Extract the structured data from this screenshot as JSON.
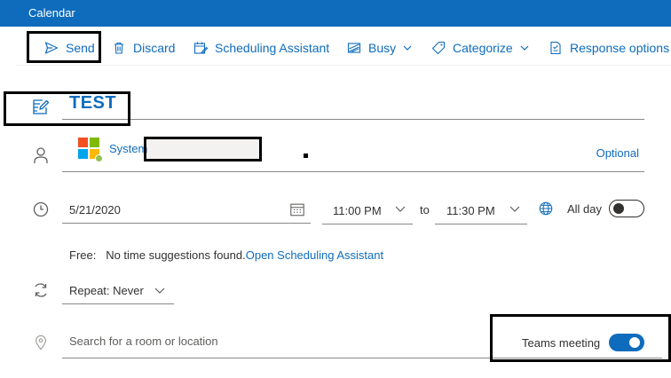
{
  "window": {
    "title": "Calendar"
  },
  "toolbar": {
    "send_label": "Send",
    "discard_label": "Discard",
    "scheduling_label": "Scheduling Assistant",
    "busy_label": "Busy",
    "categorize_label": "Categorize",
    "response_label": "Response options"
  },
  "event": {
    "title": "TEST",
    "attendee_name": "System",
    "optional_label": "Optional",
    "start_date": "5/21/2020",
    "start_time": "11:00 PM",
    "to_label": "to",
    "end_time": "11:30 PM",
    "all_day_label": "All day",
    "all_day_on": false,
    "free_label": "Free:",
    "suggestion_text": "No time suggestions found.",
    "scheduling_link": "Open Scheduling Assistant",
    "repeat_label": "Repeat:",
    "repeat_value": "Never",
    "location_placeholder": "Search for a room or location",
    "teams_label": "Teams meeting",
    "teams_on": true
  },
  "colors": {
    "accent": "#0f6cbd",
    "titlebar": "#0f6cbd",
    "text": "#323130",
    "presence": "#92c353",
    "logo_red": "#f25022",
    "logo_green": "#7fba00",
    "logo_blue": "#00a4ef",
    "logo_yellow": "#ffb900"
  },
  "icons": [
    "send-icon",
    "trash-icon",
    "scheduling-icon",
    "busy-icon",
    "tag-icon",
    "response-icon",
    "edit-title-icon",
    "person-icon",
    "clock-icon",
    "calendar-icon",
    "globe-icon",
    "repeat-icon",
    "location-icon"
  ]
}
